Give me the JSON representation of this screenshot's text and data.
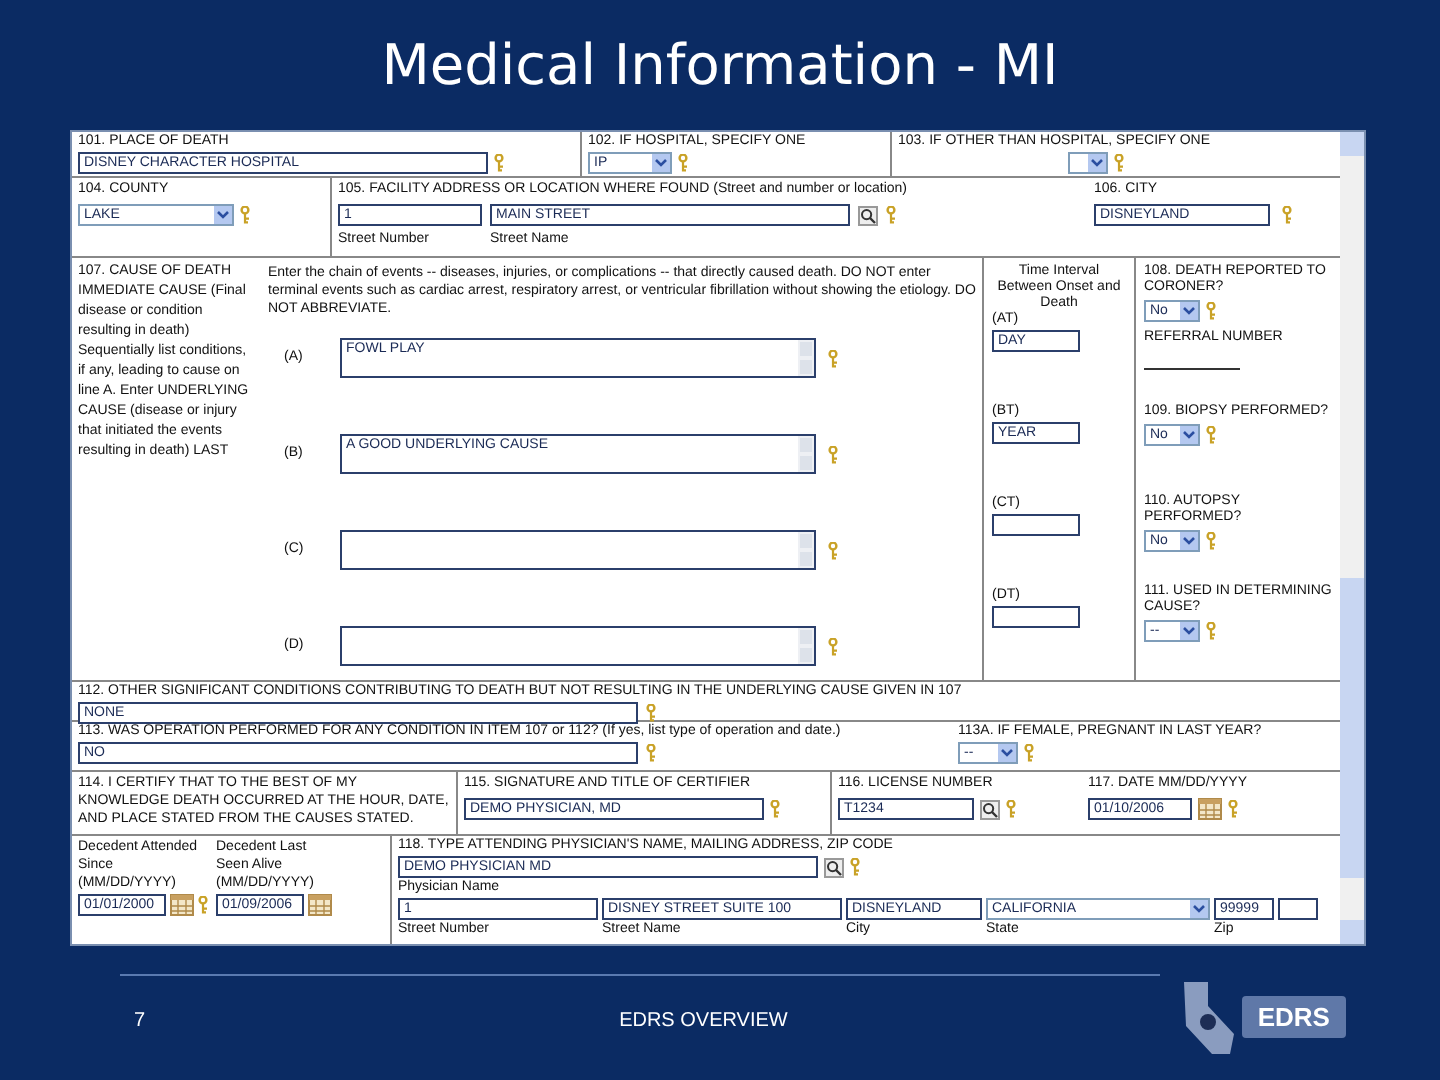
{
  "title": "Medical Information - MI",
  "form": {
    "place_of_death": {
      "label": "101. PLACE OF DEATH",
      "value": "DISNEY CHARACTER HOSPITAL"
    },
    "hospital_type": {
      "label": "102. IF HOSPITAL, SPECIFY ONE",
      "value": "IP"
    },
    "other_than_hospital": {
      "label": "103. IF OTHER THAN HOSPITAL, SPECIFY ONE"
    },
    "county": {
      "label": "104. COUNTY",
      "value": "LAKE"
    },
    "facility_address": {
      "label": "105. FACILITY ADDRESS OR LOCATION WHERE FOUND (Street and number or location)",
      "street_number": "1",
      "street_name": "MAIN STREET",
      "street_number_label": "Street Number",
      "street_name_label": "Street Name"
    },
    "city": {
      "label": "106. CITY",
      "value": "DISNEYLAND"
    },
    "cause_of_death": {
      "label": "107. CAUSE OF DEATH",
      "explanation": "IMMEDIATE CAUSE (Final disease or condition resulting in death) Sequentially list conditions, if any, leading to cause on line A. Enter UNDERLYING CAUSE (disease or injury that initiated the events resulting in death) LAST",
      "instructions": "Enter the chain of events -- diseases, injuries, or complications -- that directly caused death. DO NOT enter terminal events such as cardiac arrest, respiratory arrest, or ventricular fibrillation without showing the etiology. DO NOT ABBREVIATE.",
      "interval_label": "Time Interval Between Onset and Death",
      "lines": [
        {
          "letter": "(A)",
          "cause": "FOWL PLAY",
          "interval_label": "(AT)",
          "interval": "DAY",
          "question": {
            "label": "108. DEATH REPORTED TO CORONER?",
            "value": "No",
            "extra_label": "REFERRAL NUMBER"
          }
        },
        {
          "letter": "(B)",
          "cause": "A GOOD UNDERLYING CAUSE",
          "interval_label": "(BT)",
          "interval": "YEAR",
          "question": {
            "label": "109. BIOPSY PERFORMED?",
            "value": "No"
          }
        },
        {
          "letter": "(C)",
          "interval_label": "(CT)",
          "question": {
            "label": "110. AUTOPSY PERFORMED?",
            "value": "No"
          }
        },
        {
          "letter": "(D)",
          "interval_label": "(DT)",
          "question": {
            "label": "111. USED IN DETERMINING CAUSE?",
            "value": "--"
          }
        }
      ]
    },
    "other_conditions": {
      "label": "112. OTHER SIGNIFICANT CONDITIONS CONTRIBUTING TO DEATH BUT NOT RESULTING IN THE UNDERLYING CAUSE GIVEN IN 107",
      "value": "NONE"
    },
    "operation": {
      "label": "113. WAS OPERATION PERFORMED FOR ANY CONDITION IN ITEM 107 or 112? (If yes, list type of operation and date.)",
      "value": "NO"
    },
    "pregnant": {
      "label": "113A. IF FEMALE, PREGNANT IN LAST YEAR?",
      "value": "--"
    },
    "certify": {
      "label": "114. I CERTIFY THAT TO THE BEST OF MY KNOWLEDGE DEATH OCCURRED AT THE HOUR, DATE, AND PLACE STATED FROM THE CAUSES STATED."
    },
    "signature": {
      "label": "115. SIGNATURE AND TITLE OF CERTIFIER",
      "value": "DEMO PHYSICIAN, MD"
    },
    "license": {
      "label": "116. LICENSE NUMBER",
      "value": "T1234"
    },
    "date": {
      "label": "117. DATE MM/DD/YYYY",
      "value": "01/10/2006"
    },
    "attended_since": {
      "label": "Decedent Attended Since (MM/DD/YYYY)",
      "value": "01/01/2000"
    },
    "last_seen": {
      "label": "Decedent Last Seen Alive (MM/DD/YYYY)",
      "value": "01/09/2006"
    },
    "physician": {
      "label": "118. TYPE ATTENDING PHYSICIAN'S NAME, MAILING ADDRESS, ZIP CODE",
      "name": "DEMO PHYSICIAN MD",
      "name_label": "Physician Name",
      "street_number": "1",
      "street_name": "DISNEY STREET SUITE 100",
      "city": "DISNEYLAND",
      "state": "CALIFORNIA",
      "zip": "99999",
      "street_number_label": "Street Number",
      "street_name_label": "Street Name",
      "city_label": "City",
      "state_label": "State",
      "zip_label": "Zip"
    }
  },
  "footer": {
    "page": "7",
    "text": "EDRS OVERVIEW",
    "logo": "EDRS"
  }
}
